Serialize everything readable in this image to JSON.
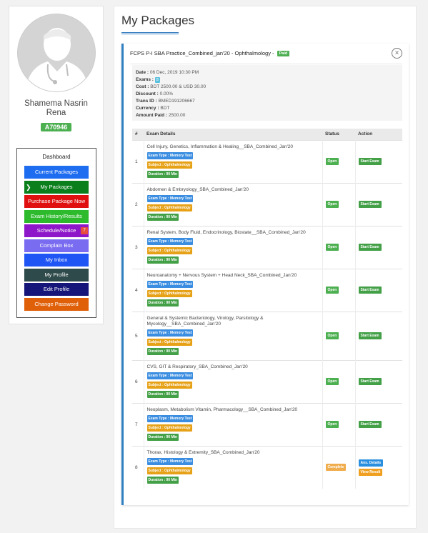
{
  "profile": {
    "name_line1": "Shamema Nasrin",
    "name_line2": "Rena",
    "badge": "A70946"
  },
  "sidebar": {
    "title": "Dashboard",
    "items": [
      {
        "label": "Current Packages",
        "color": "#1e6cf0"
      },
      {
        "label": "My Packages",
        "color": "#0b7f1c",
        "active": true
      },
      {
        "label": "Purchase Package Now",
        "color": "#e01010"
      },
      {
        "label": "Exam History/Results",
        "color": "#2dbb2d"
      },
      {
        "label": "Schedule/Notice",
        "color": "#8e18c9",
        "badge": "7"
      },
      {
        "label": "Complain Box",
        "color": "#7a6cf0"
      },
      {
        "label": "My Inbox",
        "color": "#1f55f5"
      },
      {
        "label": "My Profile",
        "color": "#2e4a4a"
      },
      {
        "label": "Edit Profile",
        "color": "#15157a"
      },
      {
        "label": "Change Password",
        "color": "#e0600a"
      }
    ]
  },
  "main": {
    "page_title": "My Packages"
  },
  "package": {
    "title": "FCPS P-I SBA Practice_Combined_jan'20 - Ophthalmology -",
    "paid_badge": "Paid",
    "close_symbol": "×",
    "info": {
      "date_label": "Date :",
      "date_value": "06 Dec, 2019 10:30 PM",
      "exams_label": "Exams :",
      "exams_value": "8",
      "cost_label": "Cost :",
      "cost_value": "BDT 2500.00 & USD 30.00",
      "discount_label": "Discount :",
      "discount_value": "0.00%",
      "trans_label": "Trans ID :",
      "trans_value": "BMED191206667",
      "currency_label": "Currency :",
      "currency_value": "BDT",
      "amount_label": "Amount Paid :",
      "amount_value": "2500.00"
    },
    "table": {
      "headers": [
        "#",
        "Exam Details",
        "Status",
        "Action"
      ],
      "type_tag": "Exam Type : Memory Test",
      "subject_tag": "Subject : Ophthalmology",
      "duration_tag": "Duration : 90 Min",
      "rows": [
        {
          "num": "1",
          "title": "Cell Injury, Genetics, Inflammation & Healing__SBA_Combined_Jan'20",
          "status": "Open",
          "action": "Start Exam"
        },
        {
          "num": "2",
          "title": "Abdomen & Embryology_SBA_Combined_Jan'20",
          "status": "Open",
          "action": "Start Exam"
        },
        {
          "num": "3",
          "title": "Renal System, Body Fluid, Endocrinology, Biostate__SBA_Combined_Jan'20",
          "status": "Open",
          "action": "Start Exam"
        },
        {
          "num": "4",
          "title": "Neuroanatomy + Nervous System + Head Neck_SBA_Combined_Jan'20",
          "status": "Open",
          "action": "Start Exam"
        },
        {
          "num": "5",
          "title": "General & Systemic Bacteriology, Virology, Parsitology & Mycology__SBA_Combined_Jan'20",
          "status": "Open",
          "action": "Start Exam"
        },
        {
          "num": "6",
          "title": "CVS, GIT & Respiratory_SBA_Combined_Jan'20",
          "status": "Open",
          "action": "Start Exam"
        },
        {
          "num": "7",
          "title": "Neoplasm, Metabolism Vitamin, Pharmacology__SBA_Combined_Jan'20",
          "status": "Open",
          "action": "Start Exam"
        },
        {
          "num": "8",
          "title": "Thorax, Histology & Extremity_SBA_Combined_Jan'20",
          "status": "Complete",
          "action": "Ans. Details",
          "action2": "View Result"
        }
      ]
    }
  }
}
